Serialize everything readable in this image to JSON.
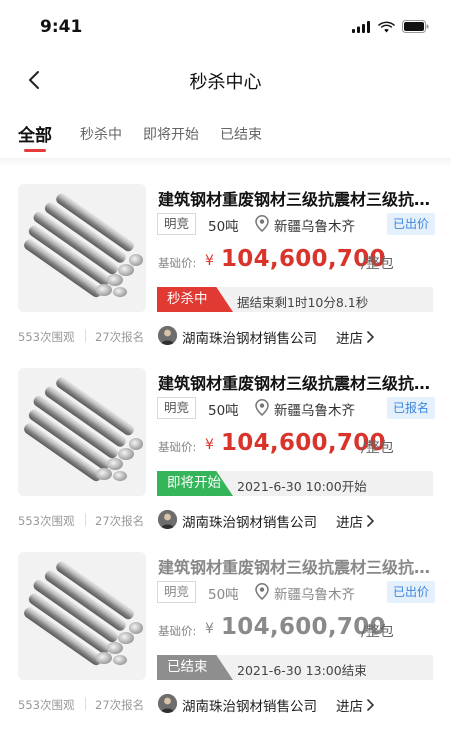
{
  "status_bar": {
    "time": "9:41"
  },
  "nav": {
    "title": "秒杀中心"
  },
  "tabs": [
    {
      "label": "全部",
      "active": true
    },
    {
      "label": "秒杀中",
      "active": false
    },
    {
      "label": "即将开始",
      "active": false
    },
    {
      "label": "已结束",
      "active": false
    }
  ],
  "items": [
    {
      "title": "建筑钢材重废钢材三级抗震材三级抗震材",
      "tag": "明竞",
      "weight": "50吨",
      "location": "新疆乌鲁木齐",
      "status_tag": "已出价",
      "price_label": "基础价:",
      "price_currency": "¥",
      "price": "104,600,700",
      "price_unit": "/整包",
      "phase": "秒杀中",
      "phase_color": "#e13a33",
      "phase_text": "据结束剩1时10分8.1秒",
      "views": "553次围观",
      "signups": "27次报名",
      "company": "湖南珠治钢材销售公司",
      "enter": "进店"
    },
    {
      "title": "建筑钢材重废钢材三级抗震材三级抗震材",
      "tag": "明竞",
      "weight": "50吨",
      "location": "新疆乌鲁木齐",
      "status_tag": "已报名",
      "price_label": "基础价:",
      "price_currency": "¥",
      "price": "104,600,700",
      "price_unit": "/整包",
      "phase": "即将开始",
      "phase_color": "#34b55a",
      "phase_text": "2021-6-30 10:00开始",
      "views": "553次围观",
      "signups": "27次报名",
      "company": "湖南珠治钢材销售公司",
      "enter": "进店"
    },
    {
      "title": "建筑钢材重废钢材三级抗震材三级抗震材",
      "tag": "明竞",
      "weight": "50吨",
      "location": "新疆乌鲁木齐",
      "status_tag": "已出价",
      "price_label": "基础价:",
      "price_currency": "¥",
      "price": "104,600,700",
      "price_unit": "/整包",
      "phase": "已结束",
      "phase_color": "#8e8e8e",
      "phase_text": "2021-6-30 13:00结束",
      "views": "553次围观",
      "signups": "27次报名",
      "company": "湖南珠治钢材销售公司",
      "enter": "进店"
    }
  ],
  "colors": {
    "accent": "#e63b3b",
    "price": "#d9342b",
    "tag_blue": "#3f86d8"
  }
}
